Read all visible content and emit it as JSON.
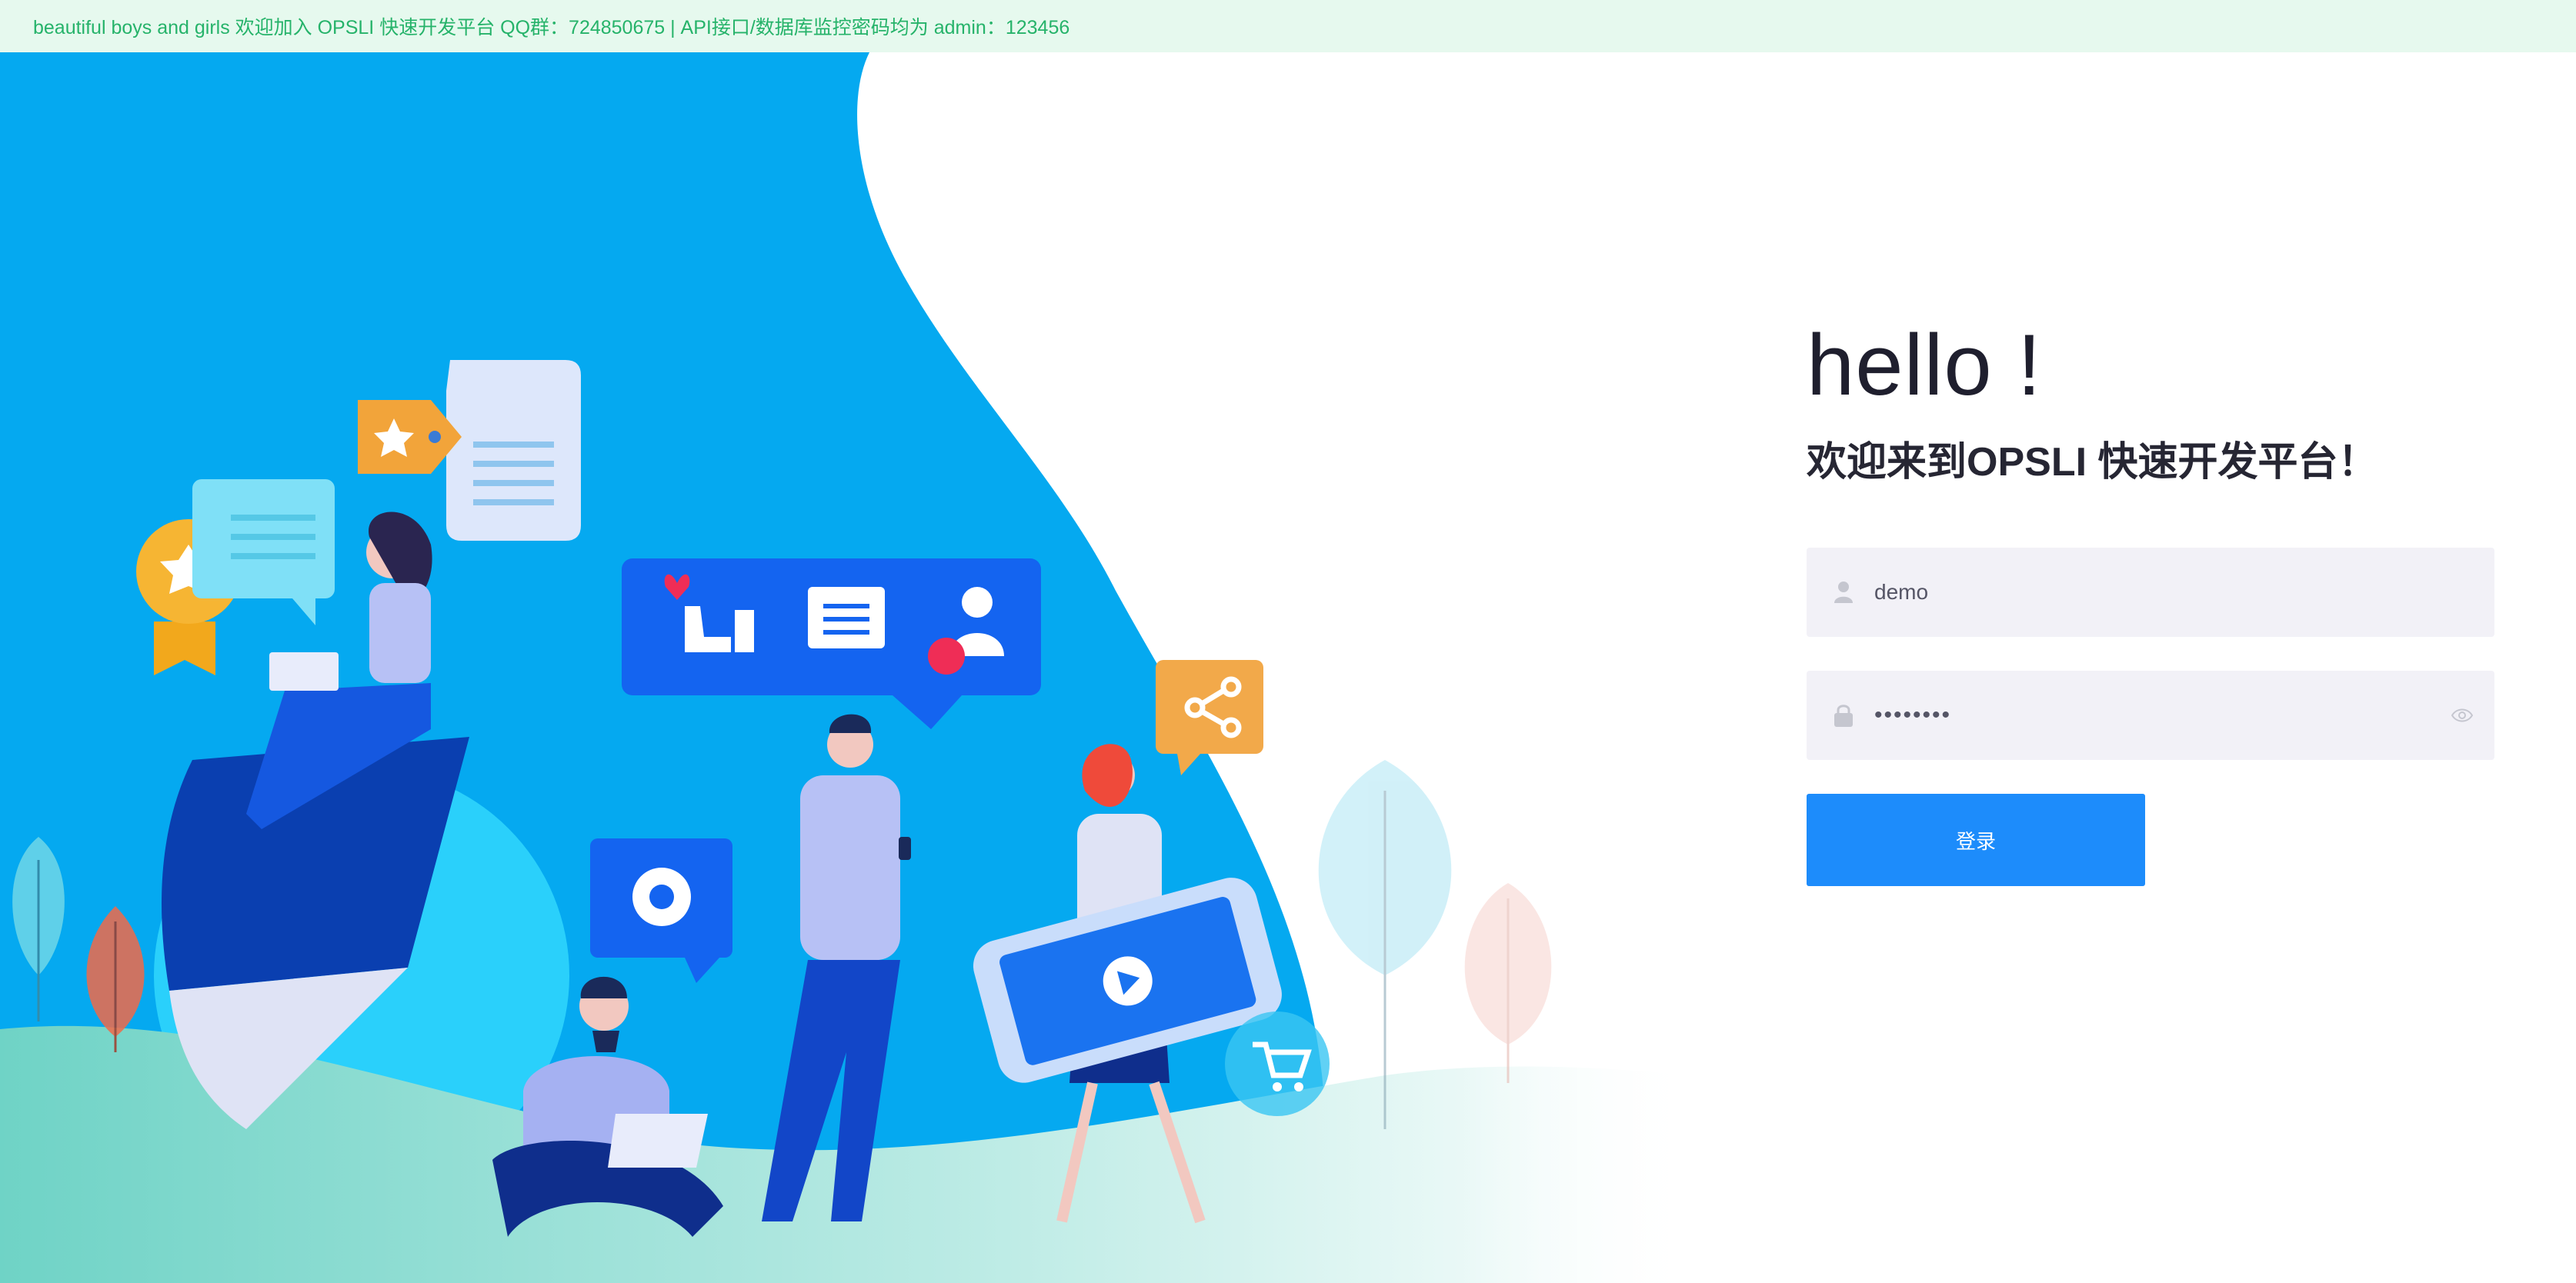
{
  "notice": {
    "text": "beautiful boys and girls 欢迎加入 OPSLI 快速开发平台 QQ群：724850675 | API接口/数据库监控密码均为 admin：123456"
  },
  "login": {
    "hello": "hello !",
    "welcome": "欢迎来到OPSLI 快速开发平台！",
    "username": {
      "value": "demo",
      "icon": "user-icon"
    },
    "password": {
      "value": "••••••••",
      "icon": "lock-icon",
      "toggle_icon": "eye-icon"
    },
    "submit_label": "登录"
  },
  "colors": {
    "notice_bg": "#e6f9ee",
    "notice_text": "#26b36a",
    "primary": "#1d8cfb",
    "input_bg": "#f2f1f7",
    "illustration_blue": "#05a9f0"
  }
}
